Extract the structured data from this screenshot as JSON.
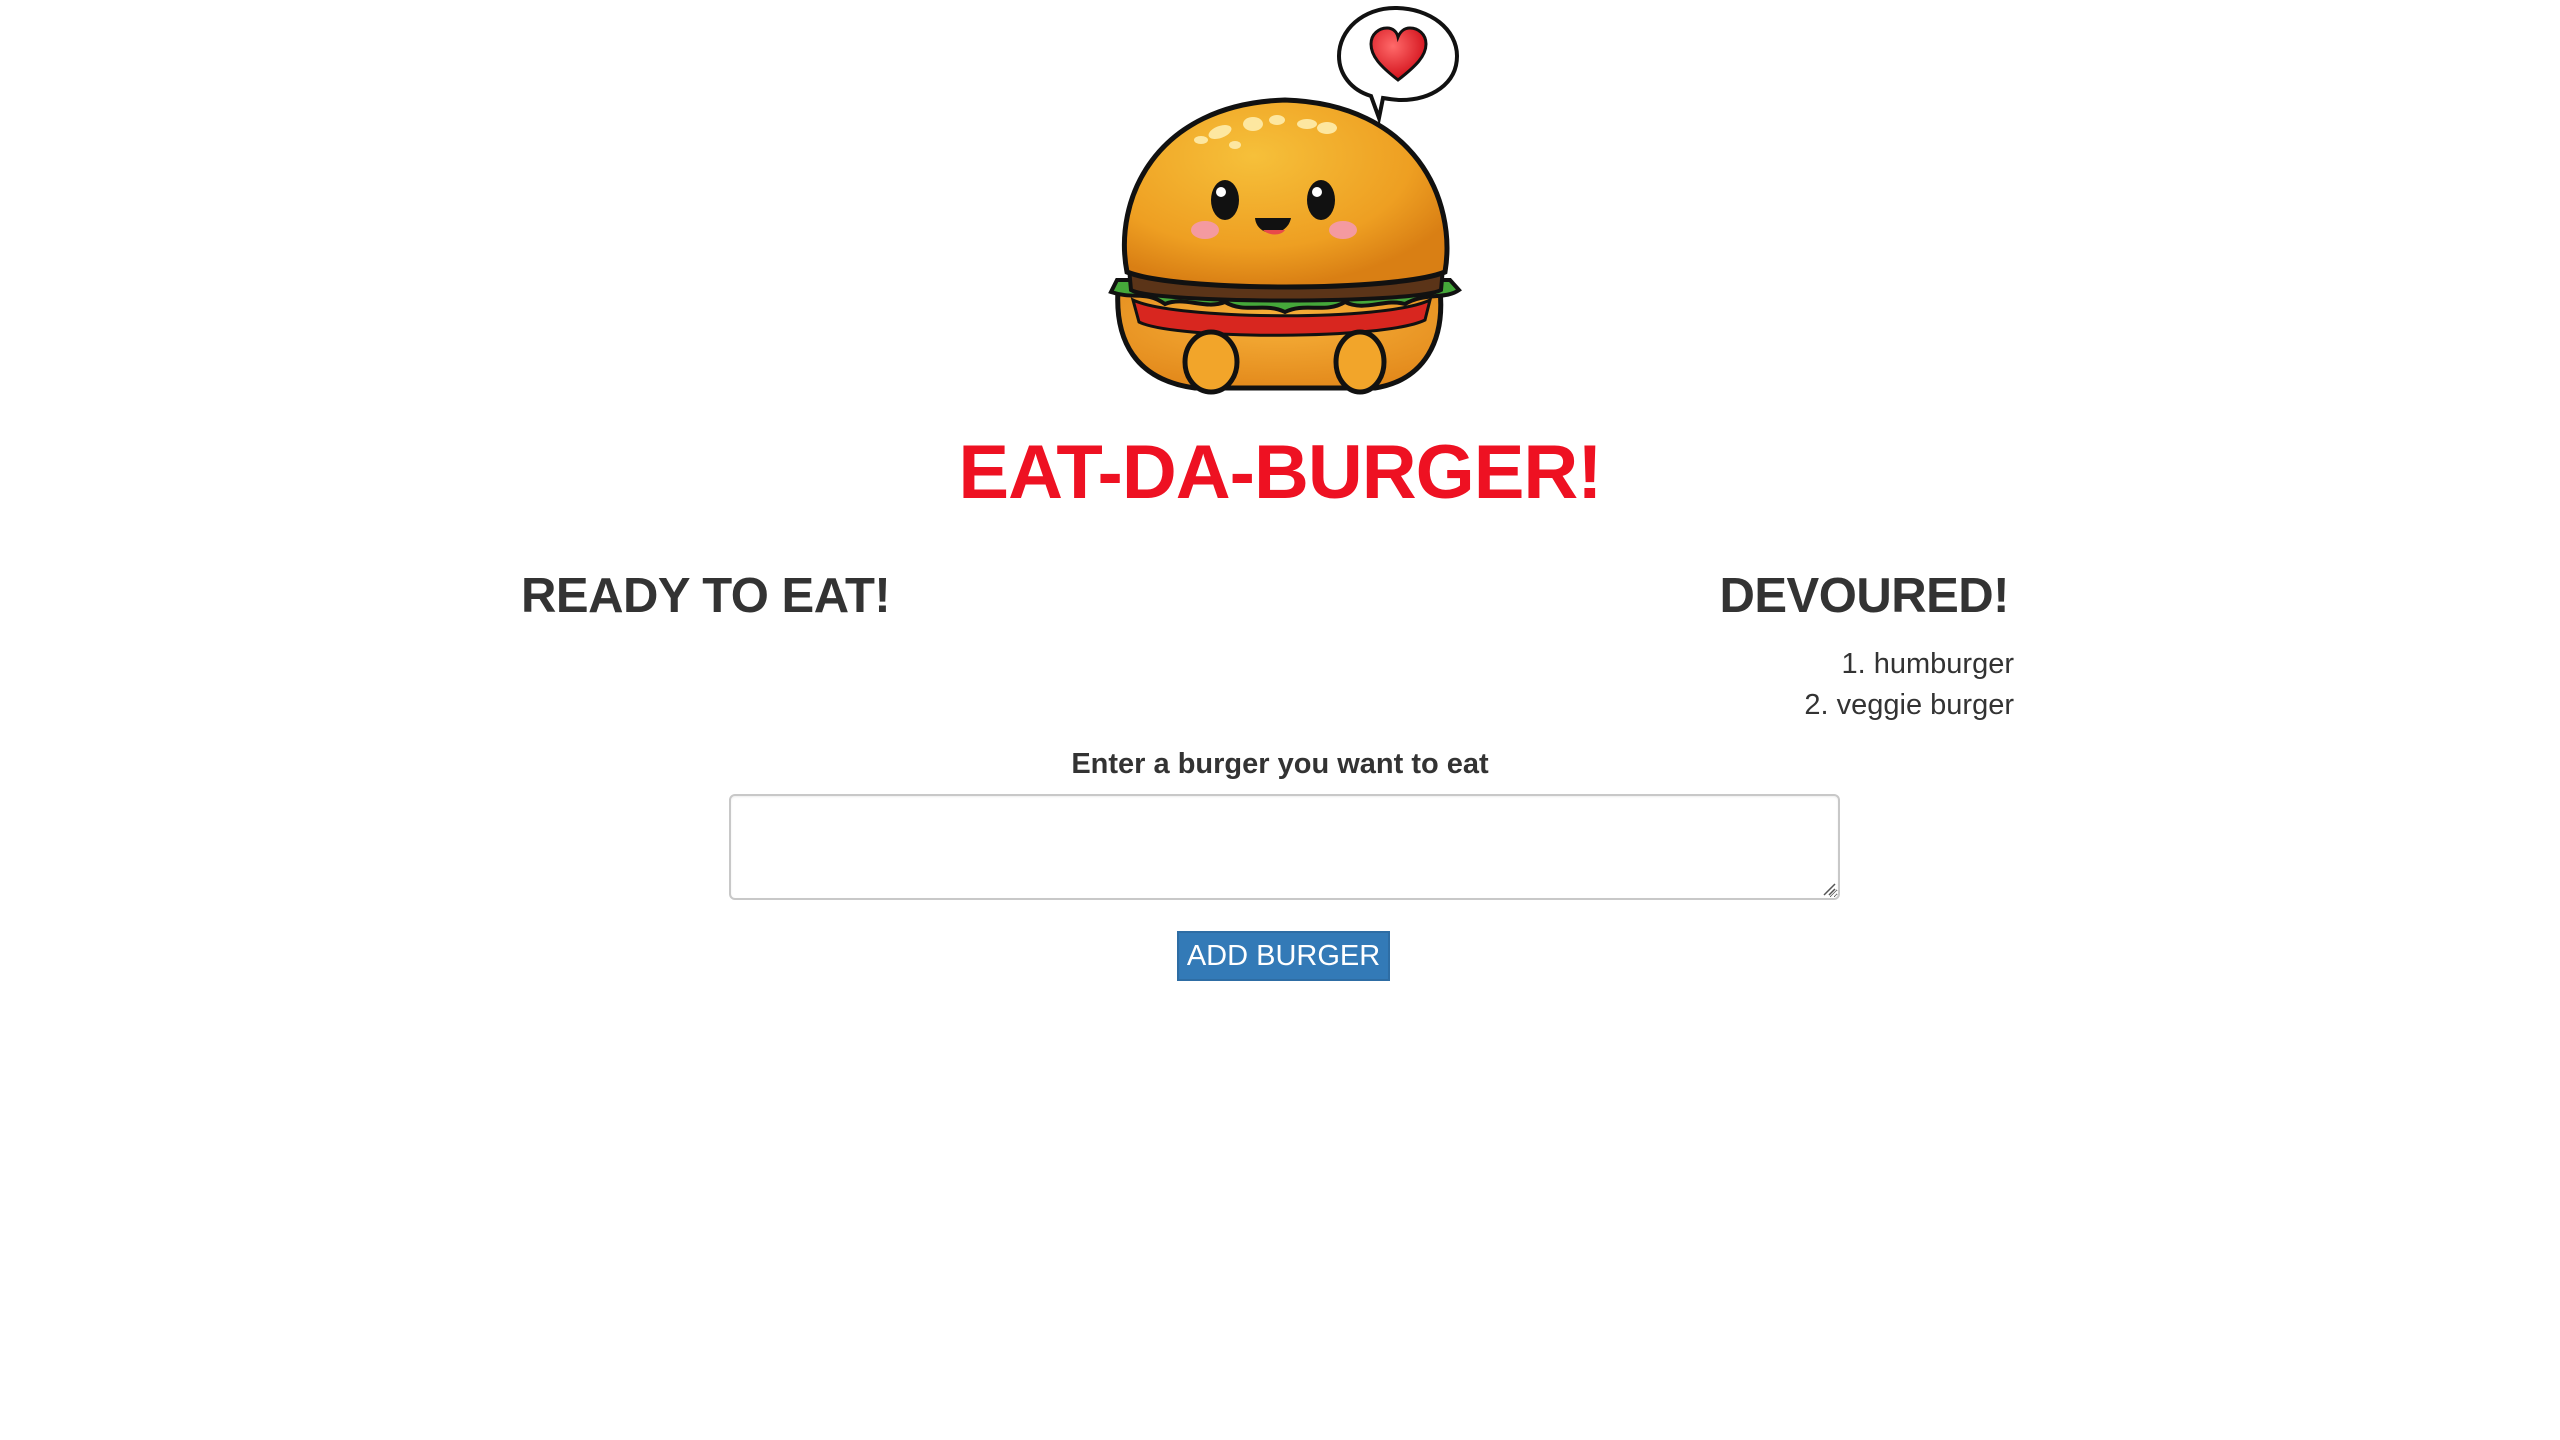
{
  "header": {
    "title": "EAT-DA-BURGER!",
    "logo_icon": "smiling-burger-with-heart-icon",
    "title_color": "#ee1122"
  },
  "ready_column": {
    "heading": "READY TO EAT!",
    "items": []
  },
  "devoured_column": {
    "heading": "DEVOURED!",
    "items": [
      {
        "number": "1.",
        "name": "humburger"
      },
      {
        "number": "2.",
        "name": "veggie burger"
      }
    ]
  },
  "form": {
    "label": "Enter a burger you want to eat",
    "input_value": "",
    "submit_label": "ADD BURGER",
    "button_color": "#337ab7"
  }
}
